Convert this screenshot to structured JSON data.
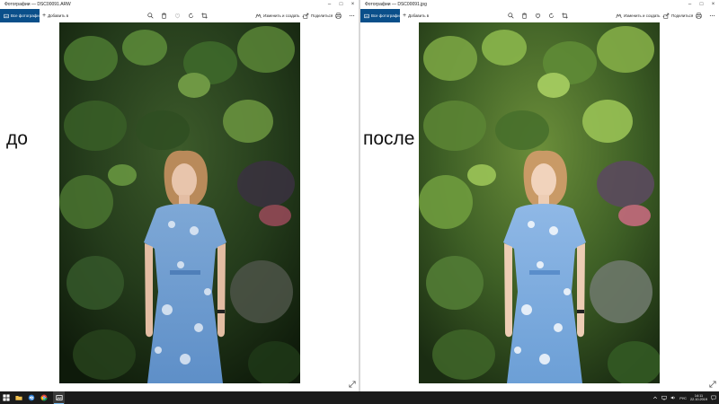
{
  "windows": [
    {
      "title": "Фотографии — DSC00091.ARW",
      "label": "до",
      "toolbar": {
        "all_photos": "Все фотографии",
        "add": "Добавить в",
        "edit": "Изменить и создать",
        "share": "Поделиться"
      }
    },
    {
      "title": "Фотографии — DSC00091.jpg",
      "label": "после",
      "toolbar": {
        "all_photos": "Все фотографии",
        "add": "Добавить в",
        "edit": "Изменить и создать",
        "share": "Поделиться"
      }
    }
  ],
  "taskbar": {
    "language": "РУС",
    "time": "14:11",
    "date": "22.10.2019"
  },
  "colors": {
    "accent": "#0a4f8a",
    "taskbar": "#1b1b1b"
  }
}
